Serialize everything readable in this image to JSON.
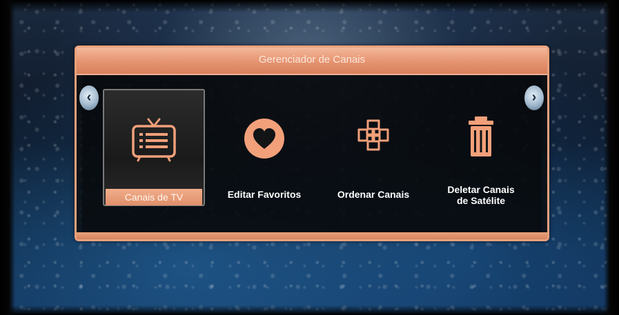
{
  "dialog": {
    "title": "Gerenciador de Canais"
  },
  "menu": {
    "items": [
      {
        "label": "Canais de TV",
        "icon": "tv-list-icon",
        "selected": true
      },
      {
        "label": "Editar Favoritos",
        "icon": "heart-icon",
        "selected": false
      },
      {
        "label": "Ordenar Canais",
        "icon": "sort-cross-icon",
        "selected": false
      },
      {
        "label_line1": "Deletar Canais",
        "label_line2": "de Satélite",
        "icon": "trash-icon",
        "selected": false
      }
    ]
  },
  "nav": {
    "left_arrow": "‹",
    "right_arrow": "›"
  },
  "colors": {
    "accent": "#e59370",
    "icon_orange": "#f2a07a",
    "title_text": "#fbe7dc"
  }
}
